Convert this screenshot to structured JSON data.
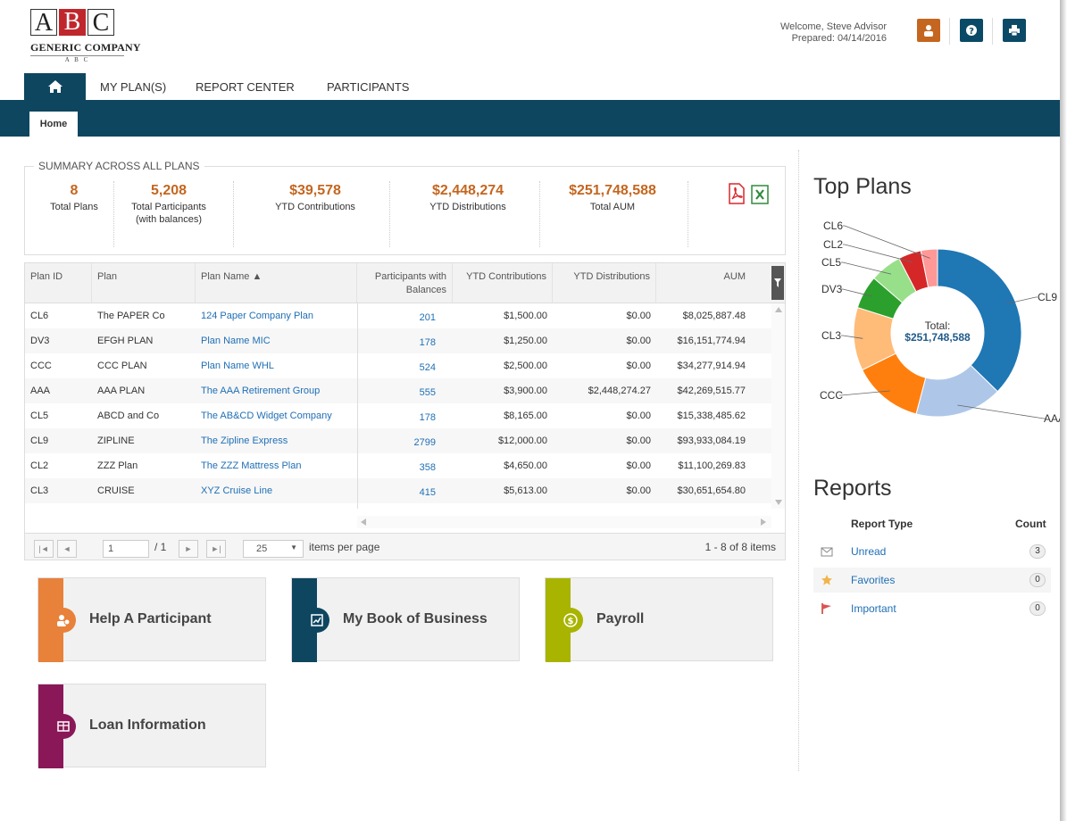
{
  "header": {
    "logo_letters": [
      "A",
      "B",
      "C"
    ],
    "logo_name": "GENERIC COMPANY",
    "logo_sub": "A B C",
    "welcome": "Welcome, Steve Advisor",
    "prepared": "Prepared: 04/14/2016",
    "icons": [
      "user-icon",
      "help-icon",
      "print-icon"
    ],
    "colors": {
      "brand_dark": "#0e4660",
      "accent_orange": "#c4661f"
    }
  },
  "nav": {
    "items": [
      "MY PLAN(S)",
      "REPORT CENTER",
      "PARTICIPANTS"
    ],
    "subtab": "Home"
  },
  "summary": {
    "legend": "SUMMARY ACROSS ALL PLANS",
    "stats": [
      {
        "value": "8",
        "label": "Total Plans"
      },
      {
        "value": "5,208",
        "label": "Total Participants",
        "label2": "(with balances)"
      },
      {
        "value": "$39,578",
        "label": "YTD Contributions"
      },
      {
        "value": "$2,448,274",
        "label": "YTD Distributions"
      },
      {
        "value": "$251,748,588",
        "label": "Total AUM"
      }
    ]
  },
  "grid": {
    "headers": [
      "Plan ID",
      "Plan",
      "Plan Name ▲",
      "Participants with",
      "Balances",
      "YTD Contributions",
      "YTD Distributions",
      "AUM"
    ],
    "rows": [
      [
        "CL6",
        "The PAPER Co",
        "124 Paper Company Plan",
        "201",
        "$1,500.00",
        "$0.00",
        "$8,025,887.48"
      ],
      [
        "DV3",
        "EFGH PLAN",
        "Plan Name MIC",
        "178",
        "$1,250.00",
        "$0.00",
        "$16,151,774.94"
      ],
      [
        "CCC",
        "CCC PLAN",
        "Plan Name WHL",
        "524",
        "$2,500.00",
        "$0.00",
        "$34,277,914.94"
      ],
      [
        "AAA",
        "AAA PLAN",
        "The AAA Retirement Group",
        "555",
        "$3,900.00",
        "$2,448,274.27",
        "$42,269,515.77"
      ],
      [
        "CL5",
        "ABCD and Co",
        "The AB&CD Widget Company",
        "178",
        "$8,165.00",
        "$0.00",
        "$15,338,485.62"
      ],
      [
        "CL9",
        "ZIPLINE",
        "The Zipline Express",
        "2799",
        "$12,000.00",
        "$0.00",
        "$93,933,084.19"
      ],
      [
        "CL2",
        "ZZZ Plan",
        "The ZZZ Mattress Plan",
        "358",
        "$4,650.00",
        "$0.00",
        "$11,100,269.83"
      ],
      [
        "CL3",
        "CRUISE",
        "XYZ Cruise Line",
        "415",
        "$5,613.00",
        "$0.00",
        "$30,651,654.80"
      ]
    ],
    "pager": {
      "page": "1",
      "of": "/ 1",
      "page_size": "25",
      "items_per_page": "items per page",
      "range": "1 - 8 of 8 items"
    }
  },
  "tiles": [
    {
      "label": "Help A Participant",
      "color": "#e8813a"
    },
    {
      "label": "My Book of Business",
      "color": "#0e4660"
    },
    {
      "label": "Payroll",
      "color": "#a8b400"
    },
    {
      "label": "Loan Information",
      "color": "#8a1858"
    }
  ],
  "top_plans": {
    "title": "Top Plans",
    "total_label": "Total:",
    "total_value": "$251,748,588"
  },
  "chart_data": {
    "type": "pie",
    "title": "Top Plans",
    "categories": [
      "CL9",
      "AAA",
      "CCC",
      "CL3",
      "DV3",
      "CL5",
      "CL2",
      "CL6"
    ],
    "values": [
      93933084.19,
      42269515.77,
      34277914.94,
      30651654.8,
      16151774.94,
      15338485.62,
      11100269.83,
      8025887.48
    ],
    "colors": [
      "#1f77b4",
      "#aec7e8",
      "#ff7f0e",
      "#ffbb78",
      "#2ca02c",
      "#98df8a",
      "#d62728",
      "#ff9896"
    ],
    "center_text": [
      "Total:",
      "$251,748,588"
    ]
  },
  "reports": {
    "title": "Reports",
    "col_type": "Report Type",
    "col_count": "Count",
    "items": [
      {
        "label": "Unread",
        "count": "3",
        "icon": "envelope-icon"
      },
      {
        "label": "Favorites",
        "count": "0",
        "icon": "star-icon"
      },
      {
        "label": "Important",
        "count": "0",
        "icon": "flag-icon"
      }
    ]
  }
}
